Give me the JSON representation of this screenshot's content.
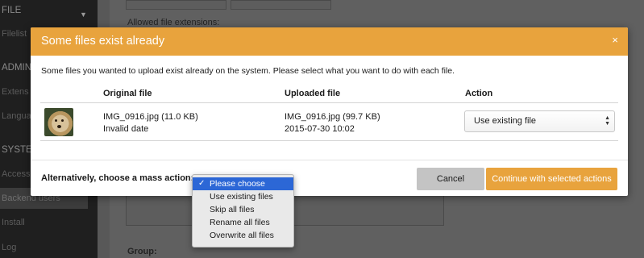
{
  "sidebar": {
    "items": [
      {
        "label": "FILE",
        "kind": "section"
      },
      {
        "label": "Filelist",
        "kind": "item"
      },
      {
        "label": "ADMIN",
        "kind": "section"
      },
      {
        "label": "Extens",
        "kind": "item"
      },
      {
        "label": "Langua",
        "kind": "item"
      },
      {
        "label": "SYSTE",
        "kind": "section"
      },
      {
        "label": "Access",
        "kind": "item"
      },
      {
        "label": "Backend users",
        "kind": "item",
        "active": true
      },
      {
        "label": "Install",
        "kind": "item"
      },
      {
        "label": "Log",
        "kind": "item"
      }
    ]
  },
  "background_form": {
    "allowed_label": "Allowed file extensions:",
    "group_label": "Group:"
  },
  "modal": {
    "title": "Some files exist already",
    "close_glyph": "×",
    "intro": "Some files you wanted to upload exist already on the system. Please select what you want to do with each file.",
    "columns": {
      "original": "Original file",
      "uploaded": "Uploaded file",
      "action": "Action"
    },
    "rows": [
      {
        "original_name": "IMG_0916.jpg (11.0 KB)",
        "original_date": "Invalid date",
        "uploaded_name": "IMG_0916.jpg (99.7 KB)",
        "uploaded_date": "2015-07-30 10:02",
        "action": "Use existing file"
      }
    ],
    "mass_action_label": "Alternatively, choose a mass action:",
    "cancel_label": "Cancel",
    "continue_label": "Continue with selected actions"
  },
  "mass_action_dropdown": {
    "options": [
      {
        "label": "Please choose",
        "selected": true
      },
      {
        "label": "Use existing files",
        "selected": false
      },
      {
        "label": "Skip all files",
        "selected": false
      },
      {
        "label": "Rename all files",
        "selected": false
      },
      {
        "label": "Overwrite all files",
        "selected": false
      }
    ],
    "check_glyph": "✓"
  },
  "colors": {
    "accent": "#e8a33d",
    "selected_option": "#2c67d6"
  }
}
